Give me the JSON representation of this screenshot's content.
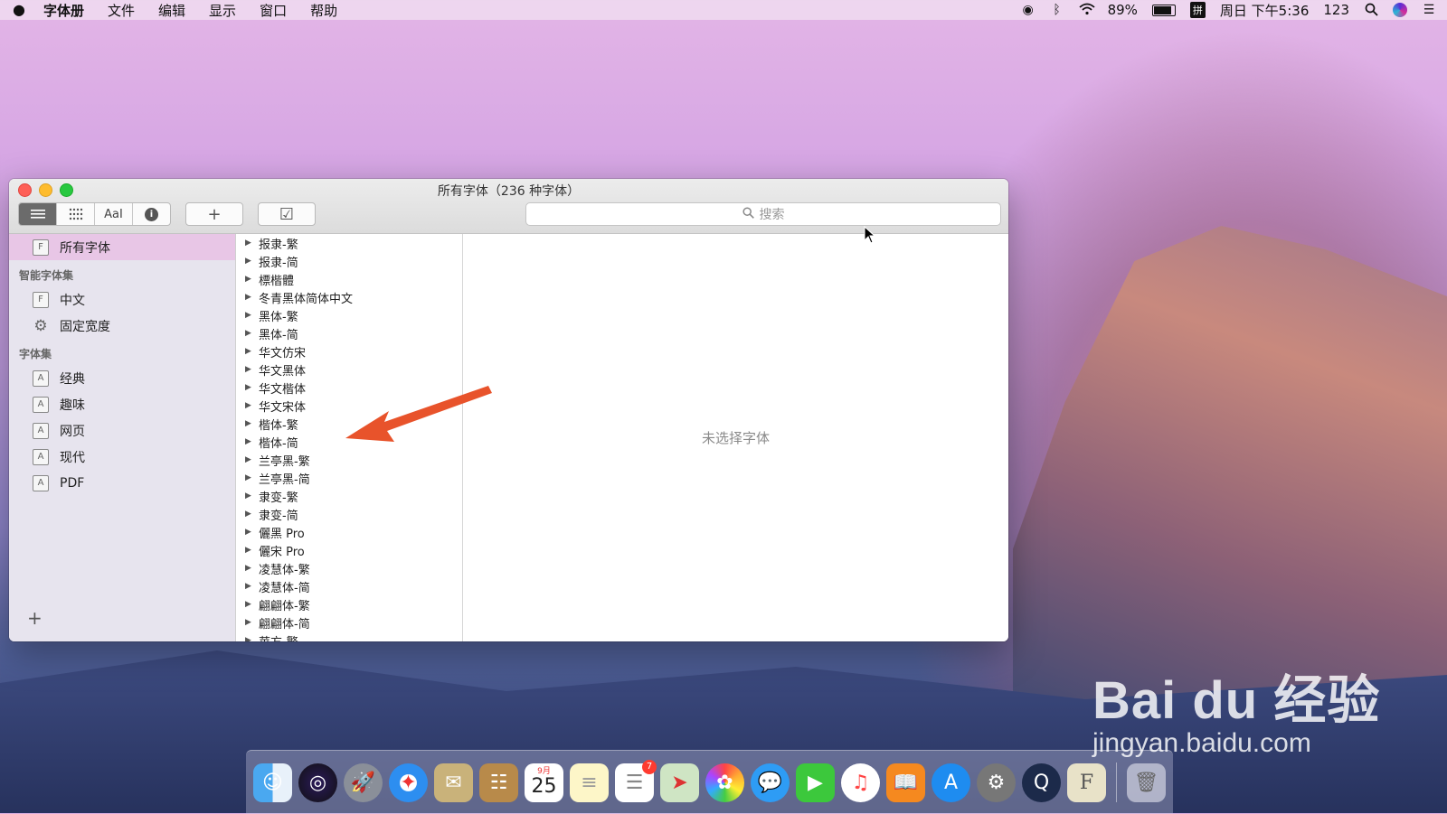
{
  "menubar": {
    "app_name": "字体册",
    "items": [
      "文件",
      "编辑",
      "显示",
      "窗口",
      "帮助"
    ],
    "status": {
      "battery_percent": "89%",
      "battery_level": 0.89,
      "input_method": "拼",
      "datetime": "周日 下午5:36",
      "user": "123"
    }
  },
  "window": {
    "title": "所有字体（236 种字体）",
    "search": {
      "placeholder": "搜索"
    },
    "toolbar": {
      "add_label": "+",
      "validate_label": "☑",
      "aa_label": "AaI",
      "info_label": "i"
    }
  },
  "sidebar": {
    "all_fonts": "所有字体",
    "smart_header": "智能字体集",
    "smart_items": [
      "中文",
      "固定宽度"
    ],
    "collections_header": "字体集",
    "collection_items": [
      "经典",
      "趣味",
      "网页",
      "现代",
      "PDF"
    ],
    "add_label": "+"
  },
  "font_list": [
    "报隶-繁",
    "报隶-简",
    "標楷體",
    "冬青黑体简体中文",
    "黑体-繁",
    "黑体-简",
    "华文仿宋",
    "华文黑体",
    "华文楷体",
    "华文宋体",
    "楷体-繁",
    "楷体-简",
    "兰亭黑-繁",
    "兰亭黑-简",
    "隶变-繁",
    "隶变-简",
    "儷黑 Pro",
    "儷宋 Pro",
    "凌慧体-繁",
    "凌慧体-简",
    "翩翩体-繁",
    "翩翩体-简",
    "苹方-繁"
  ],
  "preview": {
    "empty_text": "未选择字体"
  },
  "dock": {
    "calendar_month": "9月",
    "calendar_day": "25",
    "reminders_badge": "7"
  },
  "watermark": {
    "logo": "Bai du 经验",
    "url": "jingyan.baidu.com"
  },
  "colors": {
    "selection": "#e8c6e6",
    "arrow": "#e8532b",
    "close": "#fe5f57",
    "minimize": "#febc2e",
    "maximize": "#28c840"
  }
}
